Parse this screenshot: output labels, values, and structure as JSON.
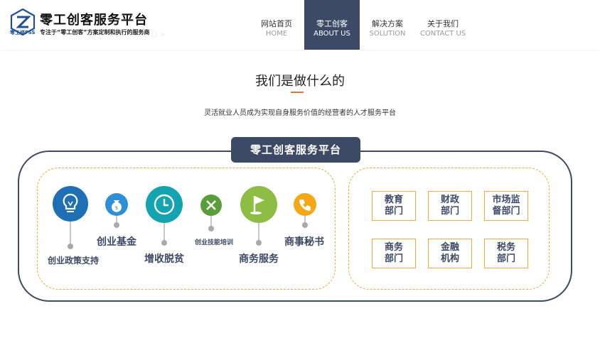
{
  "brand": {
    "title": "零工创客服务平台",
    "tagline": "专注于“零工创客”方案定制和执行的服务商",
    "logo_text": "零工修FSS"
  },
  "nav": [
    {
      "cn": "网站首页",
      "en": "HOME",
      "active": false
    },
    {
      "cn": "零工创客",
      "en": "ABOUT US",
      "active": true
    },
    {
      "cn": "解决方案",
      "en": "SOLUTION",
      "active": false
    },
    {
      "cn": "关于我们",
      "en": "CONTACT US",
      "active": false
    }
  ],
  "section": {
    "title": "我们是做什么的",
    "subtitle": "灵活就业人员成为实现自身服务价值的经营者的人才服务平台",
    "frame_title": "零工创客服务平台"
  },
  "services": [
    {
      "label": "创业政策支持",
      "icon": "lightbulb-icon",
      "color": "#1e6fb5"
    },
    {
      "label": "创业基金",
      "icon": "money-bag-icon",
      "color": "#2f8fd6"
    },
    {
      "label": "增收脱贫",
      "icon": "clock-icon",
      "color": "#14a3b0"
    },
    {
      "label": "创业技能培训",
      "icon": "tools-icon",
      "color": "#5a9e3a"
    },
    {
      "label": "商务服务",
      "icon": "flag-icon",
      "color": "#8dbe43"
    },
    {
      "label": "商事秘书",
      "icon": "phone-icon",
      "color": "#f4a818"
    }
  ],
  "departments": [
    {
      "line1": "教育",
      "line2": "部门"
    },
    {
      "line1": "财政",
      "line2": "部门"
    },
    {
      "line1": "市场监",
      "line2": "督部门"
    },
    {
      "line1": "商务",
      "line2": "部门"
    },
    {
      "line1": "金融",
      "line2": "机构"
    },
    {
      "line1": "税务",
      "line2": "部门"
    }
  ],
  "colors": {
    "navy": "#3d4a66",
    "accent_orange": "#f2a93b"
  }
}
